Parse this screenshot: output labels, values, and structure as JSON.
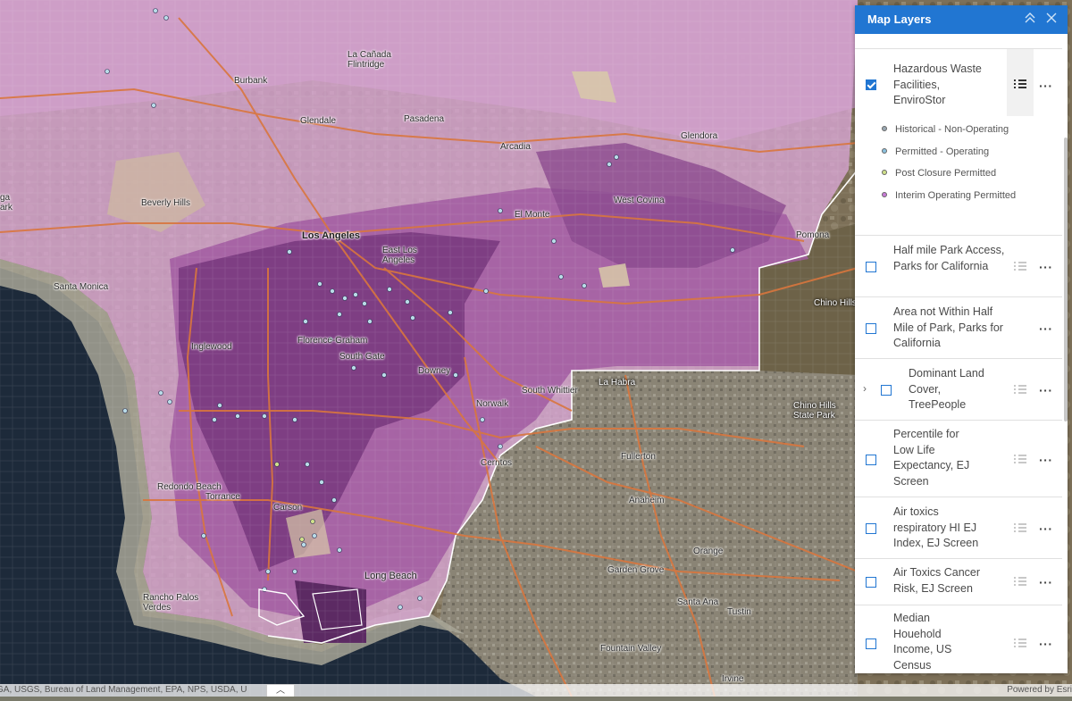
{
  "panel": {
    "title": "Map Layers",
    "collapse_icon": "chevron-double-up-icon",
    "close_icon": "close-icon",
    "layers": [
      {
        "label": "Hazardous Waste Facilities, EnviroStor",
        "checked": true,
        "legend": [
          {
            "label": "Historical - Non-Operating",
            "color": "#9aa8b2"
          },
          {
            "label": "Permitted - Operating",
            "color": "#8bc1de"
          },
          {
            "label": "Post Closure Permitted",
            "color": "#cfe08a"
          },
          {
            "label": "Interim Operating Permitted",
            "color": "#c77ad6"
          }
        ]
      },
      {
        "label": "Half mile Park Access, Parks for California",
        "checked": false
      },
      {
        "label": "Area not Within Half Mile of Park, Parks for California",
        "checked": false
      },
      {
        "label": "Dominant Land Cover, TreePeople",
        "checked": false,
        "expandable": true
      },
      {
        "label": "Percentile for Low Life Expectancy, EJ Screen",
        "checked": false
      },
      {
        "label": "Air toxics respiratory HI EJ Index, EJ Screen",
        "checked": false
      },
      {
        "label": "Air Toxics Cancer Risk, EJ Screen",
        "checked": false
      },
      {
        "label": "Median Houehold Income, US Census",
        "checked": false
      }
    ]
  },
  "map": {
    "places": [
      "La Cañada Flintridge",
      "Burbank",
      "Glendale",
      "Pasadena",
      "Arcadia",
      "Glendora",
      "Beverly Hills",
      "Los Angeles",
      "East Los Angeles",
      "El Monte",
      "West Covina",
      "Pomona",
      "Santa Monica",
      "Inglewood",
      "Florence-Graham",
      "South Gate",
      "Downey",
      "South Whittier",
      "La Habra",
      "Norwalk",
      "Chino Hills",
      "Chino Hills State Park",
      "Redondo Beach",
      "Torrance",
      "Carson",
      "Cerritos",
      "Fullerton",
      "Anaheim",
      "Orange",
      "Garden Grove",
      "Long Beach",
      "Rancho Palos Verdes",
      "Santa Ana",
      "Tustin",
      "Fountain Valley",
      "Irvine",
      "ga",
      "ark"
    ],
    "colors": {
      "ocean": "#1d2a3a",
      "choropleth_light": "#d8a8d2",
      "choropleth_dark": "#6e2f73",
      "satellite": "#7b6e55",
      "roads": "#d9763e"
    }
  },
  "attribution": {
    "left": "GA, USGS, Bureau of Land Management, EPA, NPS, USDA, U",
    "right": "Powered by Esri"
  }
}
